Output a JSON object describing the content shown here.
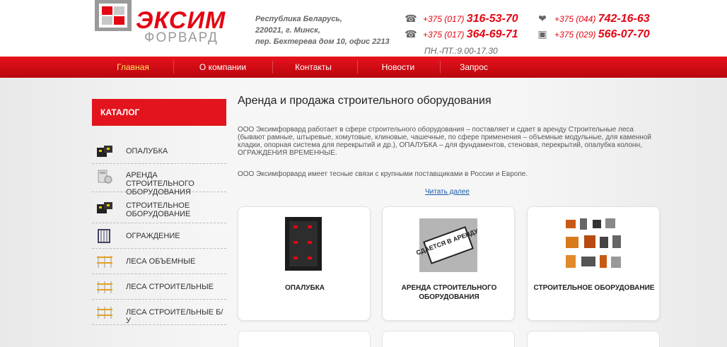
{
  "brand": {
    "name": "ЭКСИМ",
    "sub": "ФОРВАРД",
    "colors": {
      "red": "#e30613",
      "grey": "#9a9a9a"
    }
  },
  "address": {
    "line1": "Республика Беларусь,",
    "line2": "220021, г. Минск,",
    "line3": "пер. Бехтерева дом 10, офис 2213"
  },
  "phones": [
    {
      "icon": "phone-icon",
      "code": "+375 (017)",
      "number": "316-53-70"
    },
    {
      "icon": "phone-icon",
      "code": "+375 (017)",
      "number": "364-69-71"
    },
    {
      "icon": "velcom-heart-icon",
      "code": "+375 (044)",
      "number": "742-16-63"
    },
    {
      "icon": "mts-square-icon",
      "code": "+375 (029)",
      "number": "566-07-70"
    }
  ],
  "hours": "ПН.-ПТ.:9.00-17.30",
  "nav": [
    {
      "label": "Главная",
      "active": true
    },
    {
      "label": "О компании"
    },
    {
      "label": "Контакты"
    },
    {
      "label": "Новости"
    },
    {
      "label": "Запрос"
    }
  ],
  "catalog": {
    "title": "КАТАЛОГ",
    "items": [
      {
        "label": "ОПАЛУБКА",
        "icon": "formwork-icon"
      },
      {
        "label": "АРЕНДА СТРОИТЕЛЬНОГО ОБОРУДОВАНИЯ",
        "icon": "rent-calculator-icon"
      },
      {
        "label": "СТРОИТЕЛЬНОЕ ОБОРУДОВАНИЕ",
        "icon": "formwork-icon"
      },
      {
        "label": "ОГРАЖДЕНИЕ",
        "icon": "fence-icon"
      },
      {
        "label": "ЛЕСА ОБЪЕМНЫЕ",
        "icon": "scaffold-icon"
      },
      {
        "label": "ЛЕСА СТРОИТЕЛЬНЫЕ",
        "icon": "scaffold-icon"
      },
      {
        "label": "ЛЕСА СТРОИТЕЛЬНЫЕ Б/У",
        "icon": "scaffold-icon"
      }
    ]
  },
  "main": {
    "title": "Аренда и продажа строительного оборудования",
    "para1": "ООО Эксимфорвард работает в сфере строительного оборудования – поставляет и сдает в аренду Строительные леса (бывают рамные, штыревые, хомутовые, клиновые, чашечные, по сфере применения – объемные модульные, для каменной кладки, опорная система для перекрытий и др.), ОПАЛУБКА – для фундаментов, стеновая, перекрытий, опалубка колонн, ОГРАЖДЕНИЯ ВРЕМЕННЫЕ.",
    "para2": "ООО Эксимфорвард имеет тесные связи с крупными поставщиками в России и Европе.",
    "read_more": "Читать далее",
    "cards": [
      {
        "title": "ОПАЛУБКА",
        "icon": "formwork-panel-icon"
      },
      {
        "title": "АРЕНДА СТРОИТЕЛЬНОГО ОБОРУДОВАНИЯ",
        "icon": "for-rent-stamp-icon",
        "stamp": "СДАЕТСЯ В АРЕНДУ"
      },
      {
        "title": "СТРОИТЕЛЬНОЕ ОБОРУДОВАНИЕ",
        "icon": "construction-equipment-icon"
      }
    ]
  }
}
